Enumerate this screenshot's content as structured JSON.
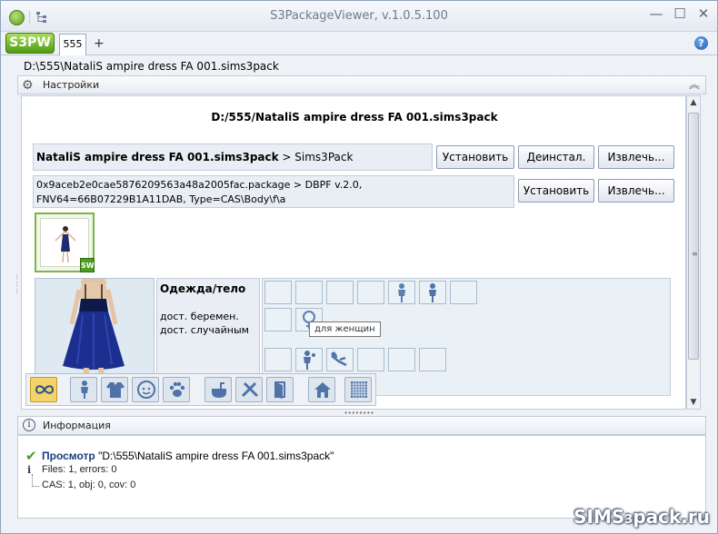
{
  "window": {
    "title": "S3PackageViewer, v.1.0.5.100",
    "minimize": "—",
    "maximize": "☐",
    "close": "✕"
  },
  "tabs": {
    "logo": "S3PW",
    "active_tab": "555",
    "add": "+",
    "help": "?"
  },
  "path": "D:\\555\\NataliS ampire dress FA 001.sims3pack",
  "settings": {
    "header": "Настройки",
    "collapse": "︽",
    "file_title": "D:/555/NataliS ampire dress FA 001.sims3pack",
    "package": {
      "name": "NataliS ampire dress FA 001.sims3pack",
      "type": " > Sims3Pack",
      "install": "Установить",
      "uninstall": "Деинстал.",
      "extract": "Извлечь..."
    },
    "resource": {
      "line1": "0x9aceb2e0cae5876209563a48a2005fac.package > DBPF v.2.0,",
      "line2": "FNV64=66B07229B1A11DAB, Type=CAS\\Body\\f\\a",
      "install": "Установить",
      "extract": "Извлечь..."
    },
    "thumbnail_badge": "SW",
    "properties": {
      "category": "Одежда/тело",
      "prop1": "дост. беремен.",
      "prop2": "дост. случайным"
    },
    "tooltip": "для женщин"
  },
  "info": {
    "header": "Информация",
    "log": {
      "action": "Просмотр",
      "action_path": " \"D:\\555\\NataliS ampire dress FA 001.sims3pack\"",
      "files": "Files: 1, errors: 0",
      "cas": "CAS: 1, obj: 0, cov: 0"
    }
  },
  "watermark": {
    "sims": "SIMS",
    "three": "3",
    "rest": "pack.ru"
  },
  "colors": {
    "accent_green": "#4f9c12",
    "panel_bg": "#e9eef4",
    "active_filter": "#f5d36b",
    "dress_blue": "#1c2f8f"
  }
}
